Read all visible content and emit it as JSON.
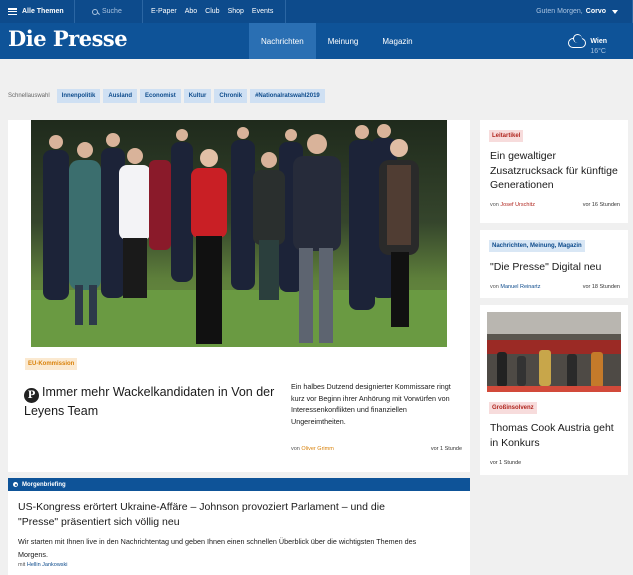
{
  "topbar": {
    "menu_label": "Alle Themen",
    "search_label": "Suche",
    "links": [
      "E-Paper",
      "Abo",
      "Club",
      "Shop",
      "Events"
    ],
    "greeting": "Guten Morgen,",
    "user_name": "Corvo"
  },
  "header": {
    "logo": "Die Presse",
    "nav": [
      "Nachrichten",
      "Meinung",
      "Magazin"
    ],
    "active_nav": "Nachrichten",
    "weather": {
      "city": "Wien",
      "temp": "16°C",
      "icon": "cloud-icon"
    }
  },
  "quick": {
    "label": "Schnellauswahl",
    "chips": [
      "Innenpolitik",
      "Ausland",
      "Economist",
      "Kultur",
      "Chronik",
      "#Nationalratswahl2019"
    ]
  },
  "hero": {
    "tag": "EU-Kommission",
    "title": "Immer mehr Wackelkandidaten in Von der Leyens Team",
    "teaser": "Ein halbes Dutzend designierter Kommissare ringt kurz vor Beginn ihrer Anhörung mit Vorwürfen von Interessenkonflikten und finanziellen Ungereimtheiten.",
    "by": "von",
    "author": "Oliver Grimm",
    "time": "vor 1 Stunde"
  },
  "briefing": {
    "label": "Morgenbriefing",
    "title": "US-Kongress erörtert Ukraine-Affäre – Johnson provoziert Parlament – und die \"Presse\" präsentiert sich völlig neu",
    "text": "Wir starten mit Ihnen live in den Nachrichtentag und geben Ihnen einen schnellen Überblick über die wichtigsten Themen des Morgens.",
    "by": "mit",
    "author": "Hellin Jankowski"
  },
  "sidebar": [
    {
      "tag": "Leitartikel",
      "title": "Ein gewaltiger Zusatzrucksack für künftige Generationen",
      "by": "von",
      "author": "Josef Urschitz",
      "time": "vor 16 Stunden"
    },
    {
      "tag": "Nachrichten, Meinung, Magazin",
      "title": "\"Die Presse\" Digital neu",
      "by": "von",
      "author": "Manuel Reinartz",
      "time": "vor 18 Stunden"
    },
    {
      "tag": "Großinsolvenz",
      "title": "Thomas Cook Austria geht in Konkurs",
      "time": "vor 1 Stunde"
    }
  ],
  "colors": {
    "brand_blue": "#0e5398",
    "accent_orange": "#d9820b",
    "accent_red": "#b0261f"
  }
}
